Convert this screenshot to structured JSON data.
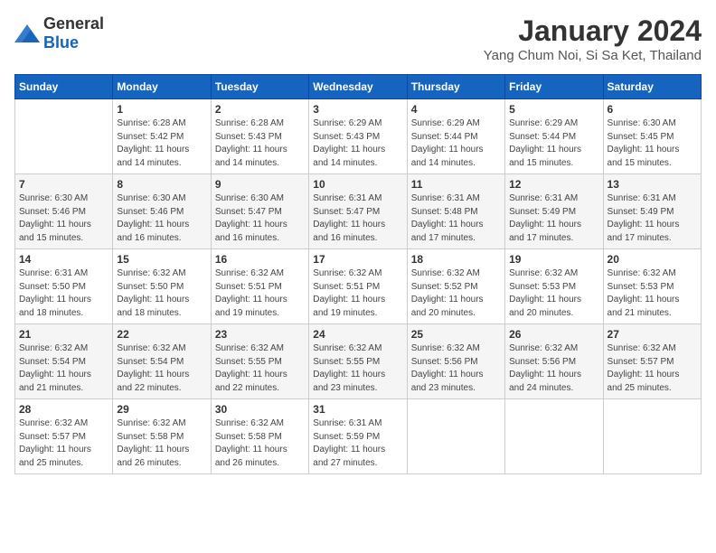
{
  "logo": {
    "general": "General",
    "blue": "Blue"
  },
  "title": "January 2024",
  "subtitle": "Yang Chum Noi, Si Sa Ket, Thailand",
  "days_of_week": [
    "Sunday",
    "Monday",
    "Tuesday",
    "Wednesday",
    "Thursday",
    "Friday",
    "Saturday"
  ],
  "weeks": [
    [
      {
        "day": "",
        "info": ""
      },
      {
        "day": "1",
        "info": "Sunrise: 6:28 AM\nSunset: 5:42 PM\nDaylight: 11 hours\nand 14 minutes."
      },
      {
        "day": "2",
        "info": "Sunrise: 6:28 AM\nSunset: 5:43 PM\nDaylight: 11 hours\nand 14 minutes."
      },
      {
        "day": "3",
        "info": "Sunrise: 6:29 AM\nSunset: 5:43 PM\nDaylight: 11 hours\nand 14 minutes."
      },
      {
        "day": "4",
        "info": "Sunrise: 6:29 AM\nSunset: 5:44 PM\nDaylight: 11 hours\nand 14 minutes."
      },
      {
        "day": "5",
        "info": "Sunrise: 6:29 AM\nSunset: 5:44 PM\nDaylight: 11 hours\nand 15 minutes."
      },
      {
        "day": "6",
        "info": "Sunrise: 6:30 AM\nSunset: 5:45 PM\nDaylight: 11 hours\nand 15 minutes."
      }
    ],
    [
      {
        "day": "7",
        "info": "Sunrise: 6:30 AM\nSunset: 5:46 PM\nDaylight: 11 hours\nand 15 minutes."
      },
      {
        "day": "8",
        "info": "Sunrise: 6:30 AM\nSunset: 5:46 PM\nDaylight: 11 hours\nand 16 minutes."
      },
      {
        "day": "9",
        "info": "Sunrise: 6:30 AM\nSunset: 5:47 PM\nDaylight: 11 hours\nand 16 minutes."
      },
      {
        "day": "10",
        "info": "Sunrise: 6:31 AM\nSunset: 5:47 PM\nDaylight: 11 hours\nand 16 minutes."
      },
      {
        "day": "11",
        "info": "Sunrise: 6:31 AM\nSunset: 5:48 PM\nDaylight: 11 hours\nand 17 minutes."
      },
      {
        "day": "12",
        "info": "Sunrise: 6:31 AM\nSunset: 5:49 PM\nDaylight: 11 hours\nand 17 minutes."
      },
      {
        "day": "13",
        "info": "Sunrise: 6:31 AM\nSunset: 5:49 PM\nDaylight: 11 hours\nand 17 minutes."
      }
    ],
    [
      {
        "day": "14",
        "info": "Sunrise: 6:31 AM\nSunset: 5:50 PM\nDaylight: 11 hours\nand 18 minutes."
      },
      {
        "day": "15",
        "info": "Sunrise: 6:32 AM\nSunset: 5:50 PM\nDaylight: 11 hours\nand 18 minutes."
      },
      {
        "day": "16",
        "info": "Sunrise: 6:32 AM\nSunset: 5:51 PM\nDaylight: 11 hours\nand 19 minutes."
      },
      {
        "day": "17",
        "info": "Sunrise: 6:32 AM\nSunset: 5:51 PM\nDaylight: 11 hours\nand 19 minutes."
      },
      {
        "day": "18",
        "info": "Sunrise: 6:32 AM\nSunset: 5:52 PM\nDaylight: 11 hours\nand 20 minutes."
      },
      {
        "day": "19",
        "info": "Sunrise: 6:32 AM\nSunset: 5:53 PM\nDaylight: 11 hours\nand 20 minutes."
      },
      {
        "day": "20",
        "info": "Sunrise: 6:32 AM\nSunset: 5:53 PM\nDaylight: 11 hours\nand 21 minutes."
      }
    ],
    [
      {
        "day": "21",
        "info": "Sunrise: 6:32 AM\nSunset: 5:54 PM\nDaylight: 11 hours\nand 21 minutes."
      },
      {
        "day": "22",
        "info": "Sunrise: 6:32 AM\nSunset: 5:54 PM\nDaylight: 11 hours\nand 22 minutes."
      },
      {
        "day": "23",
        "info": "Sunrise: 6:32 AM\nSunset: 5:55 PM\nDaylight: 11 hours\nand 22 minutes."
      },
      {
        "day": "24",
        "info": "Sunrise: 6:32 AM\nSunset: 5:55 PM\nDaylight: 11 hours\nand 23 minutes."
      },
      {
        "day": "25",
        "info": "Sunrise: 6:32 AM\nSunset: 5:56 PM\nDaylight: 11 hours\nand 23 minutes."
      },
      {
        "day": "26",
        "info": "Sunrise: 6:32 AM\nSunset: 5:56 PM\nDaylight: 11 hours\nand 24 minutes."
      },
      {
        "day": "27",
        "info": "Sunrise: 6:32 AM\nSunset: 5:57 PM\nDaylight: 11 hours\nand 25 minutes."
      }
    ],
    [
      {
        "day": "28",
        "info": "Sunrise: 6:32 AM\nSunset: 5:57 PM\nDaylight: 11 hours\nand 25 minutes."
      },
      {
        "day": "29",
        "info": "Sunrise: 6:32 AM\nSunset: 5:58 PM\nDaylight: 11 hours\nand 26 minutes."
      },
      {
        "day": "30",
        "info": "Sunrise: 6:32 AM\nSunset: 5:58 PM\nDaylight: 11 hours\nand 26 minutes."
      },
      {
        "day": "31",
        "info": "Sunrise: 6:31 AM\nSunset: 5:59 PM\nDaylight: 11 hours\nand 27 minutes."
      },
      {
        "day": "",
        "info": ""
      },
      {
        "day": "",
        "info": ""
      },
      {
        "day": "",
        "info": ""
      }
    ]
  ]
}
